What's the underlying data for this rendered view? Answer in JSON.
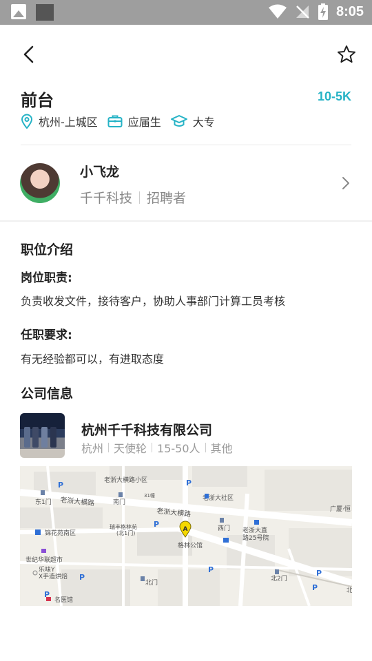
{
  "status_bar": {
    "time": "8:05"
  },
  "header": {
    "back_icon": "chevron-left-icon",
    "favorite_icon": "star-outline-icon"
  },
  "job": {
    "title": "前台",
    "salary": "10-5K",
    "location": "杭州-上城区",
    "experience": "应届生",
    "education": "大专"
  },
  "recruiter": {
    "name": "小飞龙",
    "company": "千千科技",
    "role": "招聘者"
  },
  "description": {
    "section_title": "职位介绍",
    "duties_title": "岗位职责:",
    "duties_text": "负责收发文件，接待客户，协助人事部门计算工员考核",
    "requirements_title": "任职要求:",
    "requirements_text": "有无经验都可以，有进取态度"
  },
  "company": {
    "section_title": "公司信息",
    "name": "杭州千千科技有限公司",
    "city": "杭州",
    "stage": "天使轮",
    "size": "15-50人",
    "industry": "其他"
  },
  "map": {
    "labels": {
      "l1": "老浙大横路小区",
      "l2": "老浙大社区",
      "l3": "老浙大横路",
      "l4": "老浙大横路",
      "l5": "东1门",
      "l6": "南门",
      "l7": "31幢",
      "l8": "广厦·恒",
      "l9": "锦花苑南区",
      "l10": "瑞丰格林苑",
      "l11": "(北1门)",
      "l12": "西门",
      "l13": "老浙大直",
      "l14": "路25号院",
      "l15": "格林公馆",
      "l16": "世纪华联超市",
      "l17": "乐味Y",
      "l18": "X手造烘焙",
      "l19": "北门",
      "l20": "北2门",
      "l21": "名医馆",
      "l22": "北"
    },
    "marker": "A"
  },
  "colors": {
    "accent": "#26b3c6",
    "poi": "#2f6fd6"
  }
}
